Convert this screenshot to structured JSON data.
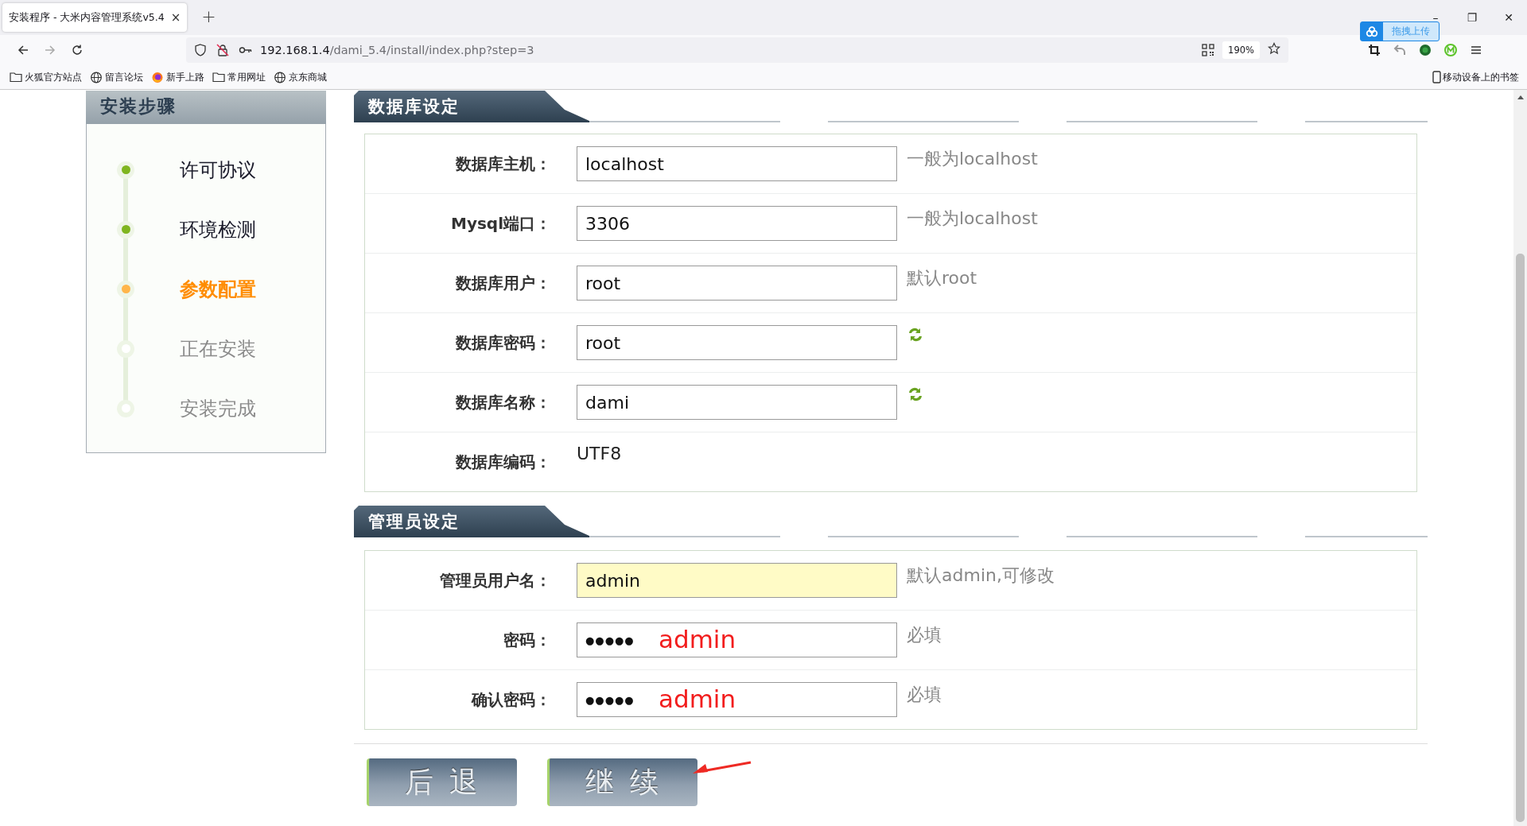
{
  "browser": {
    "tab": {
      "title": "安装程序 - 大米内容管理系统v5.4",
      "close": "×"
    },
    "new_tab": "+",
    "window_controls": [
      "–",
      "❐",
      "✕"
    ],
    "url": {
      "host": "192.168.1.4",
      "path": "/dami_5.4/install/index.php?step=3"
    },
    "zoom": "190%",
    "upload_badge": "拖拽上传",
    "bookmarks": [
      {
        "label": "火狐官方站点",
        "kind": "folder"
      },
      {
        "label": "留言论坛",
        "kind": "globe"
      },
      {
        "label": "新手上路",
        "kind": "firefox"
      },
      {
        "label": "常用网址",
        "kind": "folder"
      },
      {
        "label": "京东商城",
        "kind": "globe"
      }
    ],
    "mobile_bookmarks": "移动设备上的书签"
  },
  "sidebar": {
    "title": "安装步骤",
    "steps": [
      {
        "label": "许可协议",
        "done": true,
        "selected": false
      },
      {
        "label": "环境检测",
        "done": true,
        "selected": false
      },
      {
        "label": "参数配置",
        "done": false,
        "selected": true
      },
      {
        "label": "正在安装",
        "done": false,
        "selected": false
      },
      {
        "label": "安装完成",
        "done": false,
        "selected": false
      }
    ]
  },
  "sections": [
    {
      "title": "数据库设定",
      "rows": [
        {
          "label": "数据库主机：",
          "kind": "input",
          "value": "localhost",
          "hint": "一般为localhost",
          "highlighted": false
        },
        {
          "label": "Mysql端口：",
          "kind": "input",
          "value": "3306",
          "hint": "一般为localhost",
          "highlighted": false
        },
        {
          "label": "数据库用户：",
          "kind": "input",
          "value": "root",
          "hint": "默认root",
          "highlighted": false
        },
        {
          "label": "数据库密码：",
          "kind": "refresh",
          "value": "root",
          "highlighted": false
        },
        {
          "label": "数据库名称：",
          "kind": "refresh",
          "value": "dami",
          "highlighted": false
        },
        {
          "label": "数据库编码：",
          "kind": "static",
          "value": "UTF8"
        }
      ]
    },
    {
      "title": "管理员设定",
      "rows": [
        {
          "label": "管理员用户名：",
          "kind": "input",
          "value": "admin",
          "hint": "默认admin,可修改",
          "highlighted": true
        },
        {
          "label": "密码：",
          "kind": "password",
          "value": "●●●●●",
          "note": "admin",
          "hint": "必填",
          "highlighted": false
        },
        {
          "label": "确认密码：",
          "kind": "password",
          "value": "●●●●●",
          "note": "admin",
          "hint": "必填",
          "highlighted": false
        }
      ]
    }
  ],
  "buttons": [
    "后 退",
    "继 续"
  ]
}
